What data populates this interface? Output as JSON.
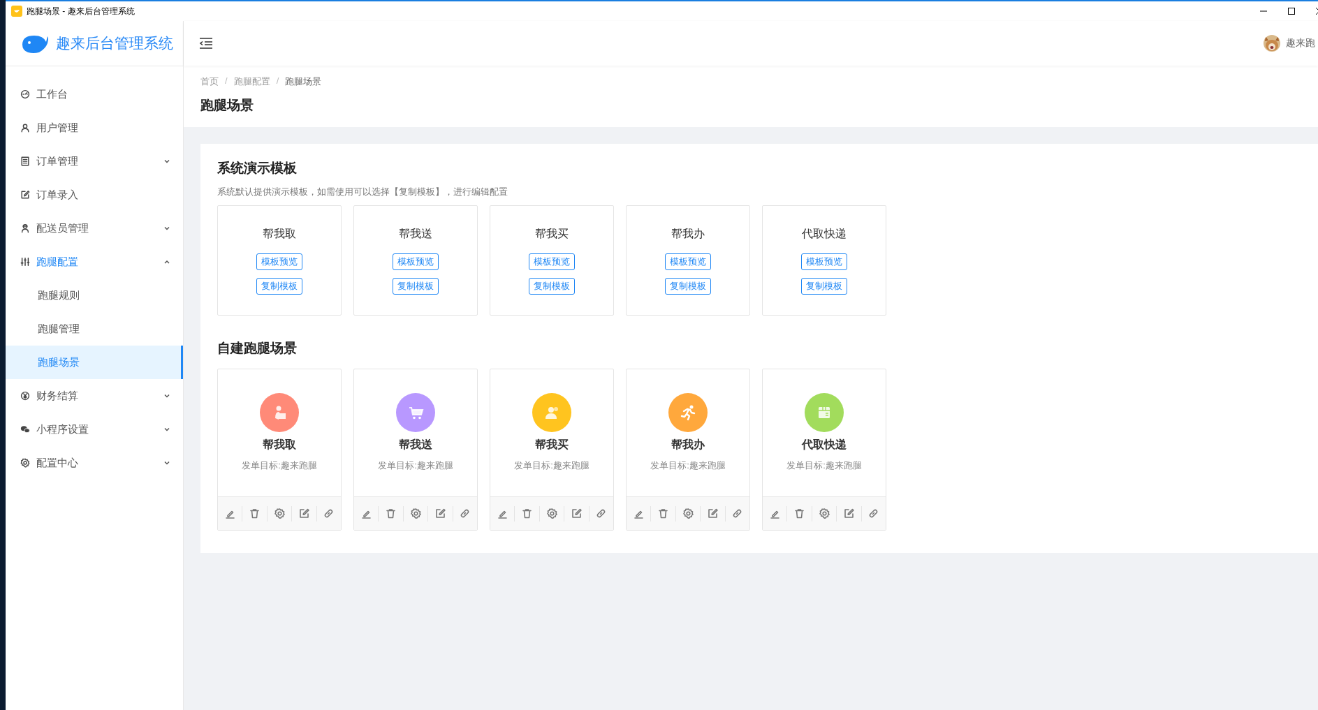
{
  "window": {
    "title": "跑腿场景 - 趣来后台管理系统"
  },
  "sidebar": {
    "logo_text": "趣来后台管理系统",
    "items": [
      {
        "label": "工作台",
        "kind": "link",
        "selected": false
      },
      {
        "label": "用户管理",
        "kind": "link",
        "selected": false
      },
      {
        "label": "订单管理",
        "kind": "group",
        "expanded": false,
        "selected": false
      },
      {
        "label": "订单录入",
        "kind": "link",
        "selected": false
      },
      {
        "label": "配送员管理",
        "kind": "group",
        "expanded": false,
        "selected": false
      },
      {
        "label": "跑腿配置",
        "kind": "group",
        "expanded": true,
        "selected": false,
        "children": [
          {
            "label": "跑腿规则",
            "selected": false
          },
          {
            "label": "跑腿管理",
            "selected": false
          },
          {
            "label": "跑腿场景",
            "selected": true
          }
        ]
      },
      {
        "label": "财务结算",
        "kind": "group",
        "expanded": false,
        "selected": false
      },
      {
        "label": "小程序设置",
        "kind": "group",
        "expanded": false,
        "selected": false
      },
      {
        "label": "配置中心",
        "kind": "group",
        "expanded": false,
        "selected": false
      }
    ]
  },
  "header": {
    "user_name": "趣来跑"
  },
  "breadcrumb": [
    "首页",
    "跑腿配置",
    "跑腿场景"
  ],
  "breadcrumb_separator": "/",
  "page_title": "跑腿场景",
  "demo_templates": {
    "title": "系统演示模板",
    "description": "系统默认提供演示模板，如需使用可以选择【复制模板】，进行编辑配置",
    "cards": [
      {
        "name": "帮我取",
        "buttons": [
          "模板预览",
          "复制模板"
        ]
      },
      {
        "name": "帮我送",
        "buttons": [
          "模板预览",
          "复制模板"
        ]
      },
      {
        "name": "帮我买",
        "buttons": [
          "模板预览",
          "复制模板"
        ]
      },
      {
        "name": "帮我办",
        "buttons": [
          "模板预览",
          "复制模板"
        ]
      },
      {
        "name": "代取快递",
        "buttons": [
          "模板预览",
          "复制模板"
        ]
      }
    ]
  },
  "custom_scenes": {
    "title": "自建跑腿场景",
    "cards": [
      {
        "name": "帮我取",
        "target": "发单目标:趣来跑腿",
        "color": "#ff8a78"
      },
      {
        "name": "帮我送",
        "target": "发单目标:趣来跑腿",
        "color": "#b898ff"
      },
      {
        "name": "帮我买",
        "target": "发单目标:趣来跑腿",
        "color": "#ffc41f"
      },
      {
        "name": "帮我办",
        "target": "发单目标:趣来跑腿",
        "color": "#ffa83c"
      },
      {
        "name": "代取快递",
        "target": "发单目标:趣来跑腿",
        "color": "#a2dc5c"
      }
    ]
  }
}
